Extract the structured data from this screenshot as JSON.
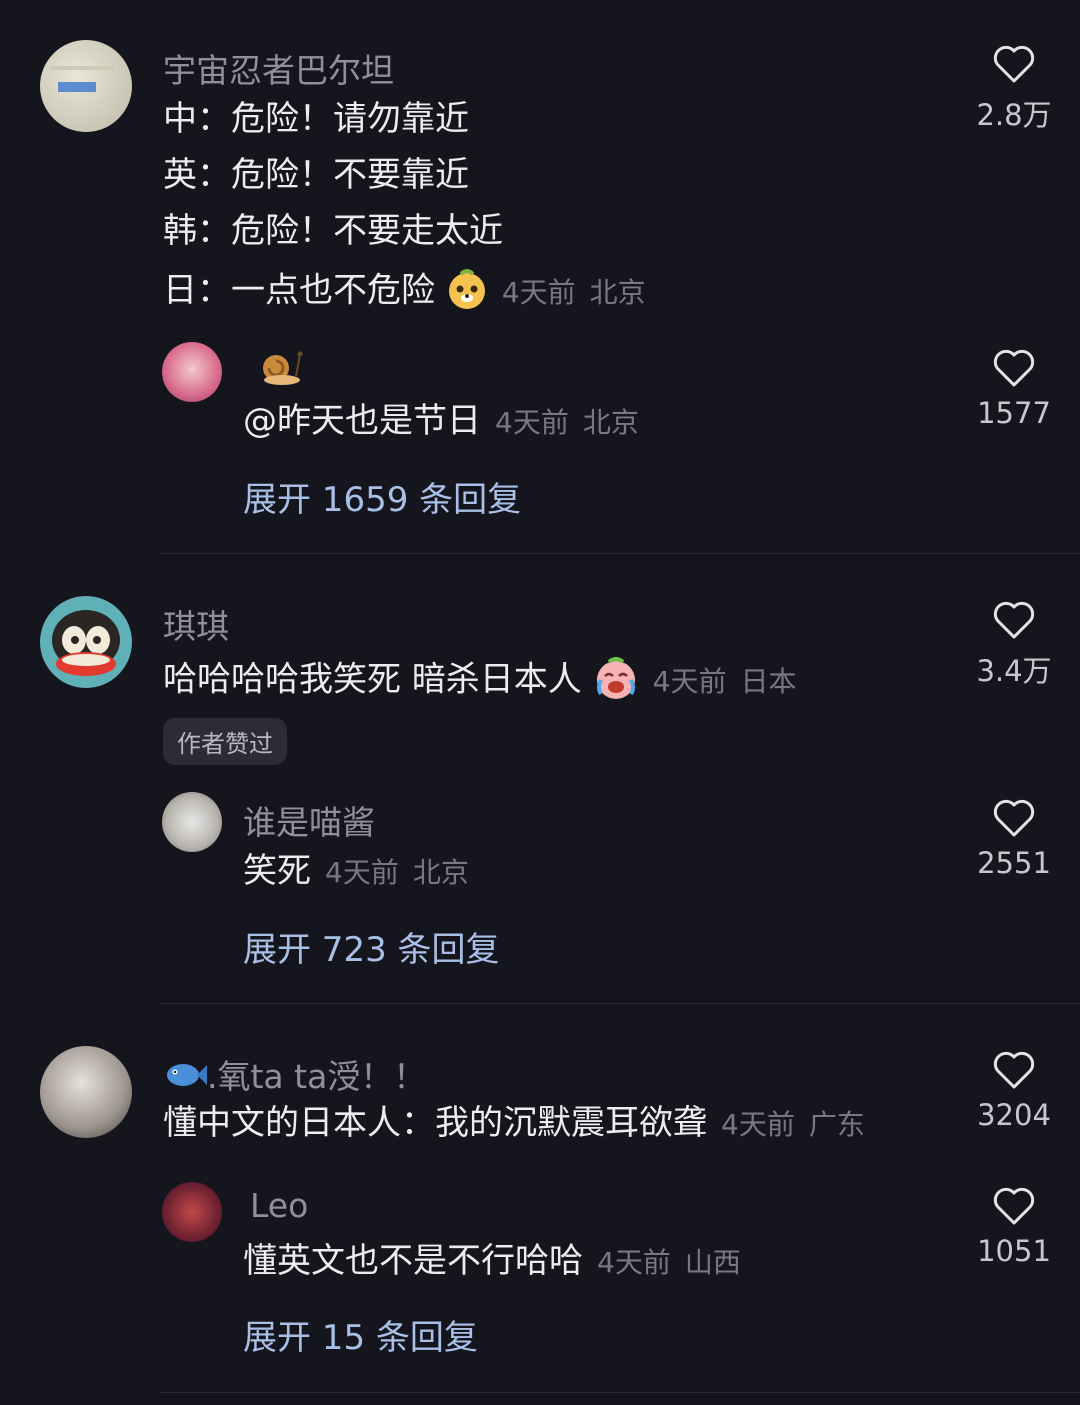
{
  "comments": [
    {
      "username": "宇宙忍者巴尔坦",
      "lines": [
        "中：危险！请勿靠近",
        "英：危险！不要靠近",
        "韩：危险！不要走太近",
        "日：一点也不危险"
      ],
      "emoji": "dog-face-emoji",
      "time": "4天前",
      "location": "北京",
      "likes": "2.8万",
      "reply": {
        "username_emoji": "snail-emoji",
        "text": "@昨天也是节日",
        "time": "4天前",
        "location": "北京",
        "likes": "1577"
      },
      "expand_label": "展开 1659 条回复"
    },
    {
      "username": "琪琪",
      "text": "哈哈哈哈我笑死 暗杀日本人",
      "emoji": "crying-laughing-emoji",
      "time": "4天前",
      "location": "日本",
      "likes": "3.4万",
      "badge": "作者赞过",
      "reply": {
        "username": "谁是喵酱",
        "text": "笑死",
        "time": "4天前",
        "location": "北京",
        "likes": "2551"
      },
      "expand_label": "展开 723 条回复"
    },
    {
      "username_prefix_emoji": "fish-emoji",
      "username": ".氧ta ta涭！！",
      "text": "懂中文的日本人：我的沉默震耳欲聋",
      "time": "4天前",
      "location": "广东",
      "likes": "3204",
      "reply": {
        "username": "Leo",
        "text": "懂英文也不是不行哈哈",
        "time": "4天前",
        "location": "山西",
        "likes": "1051"
      },
      "expand_label": "展开 15 条回复"
    }
  ],
  "colors": {
    "background": "#15151d",
    "primary_text": "#ececf1",
    "secondary_text": "#8f9099",
    "meta_text": "#777883",
    "expand_link": "#a9bfe6"
  }
}
